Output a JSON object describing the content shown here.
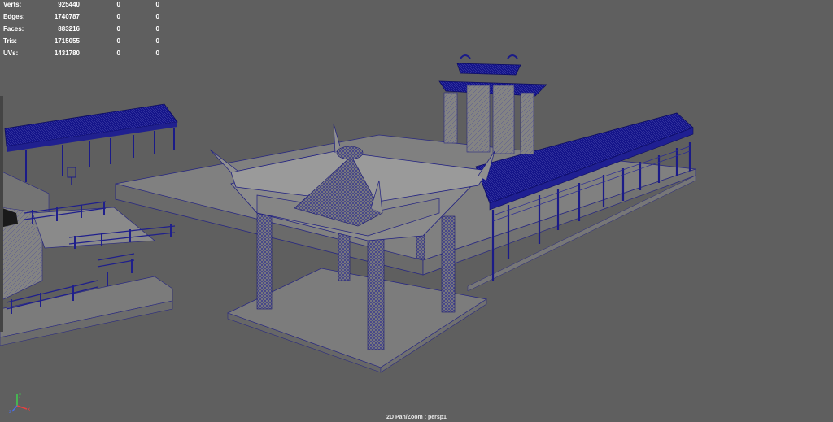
{
  "hud": {
    "rows": [
      {
        "label": "Verts:",
        "total": "925440",
        "selected": "0",
        "tris": "0"
      },
      {
        "label": "Edges:",
        "total": "1740787",
        "selected": "0",
        "tris": "0"
      },
      {
        "label": "Faces:",
        "total": "883216",
        "selected": "0",
        "tris": "0"
      },
      {
        "label": "Tris:",
        "total": "1715055",
        "selected": "0",
        "tris": "0"
      },
      {
        "label": "UVs:",
        "total": "1431780",
        "selected": "0",
        "tris": "0"
      }
    ]
  },
  "status": {
    "text": "2D Pan/Zoom : persp1"
  },
  "axis": {
    "x_label": "x",
    "y_label": "y",
    "z_label": "z"
  },
  "colors": {
    "viewport_bg": "#5f5f5f",
    "wire": "#1a1a8c",
    "roof_blue": "#16168a",
    "geometry_gray": "#7d7d7d",
    "axis_x": "#e84040",
    "axis_y": "#3fd14f",
    "axis_z": "#4a6ee8"
  }
}
